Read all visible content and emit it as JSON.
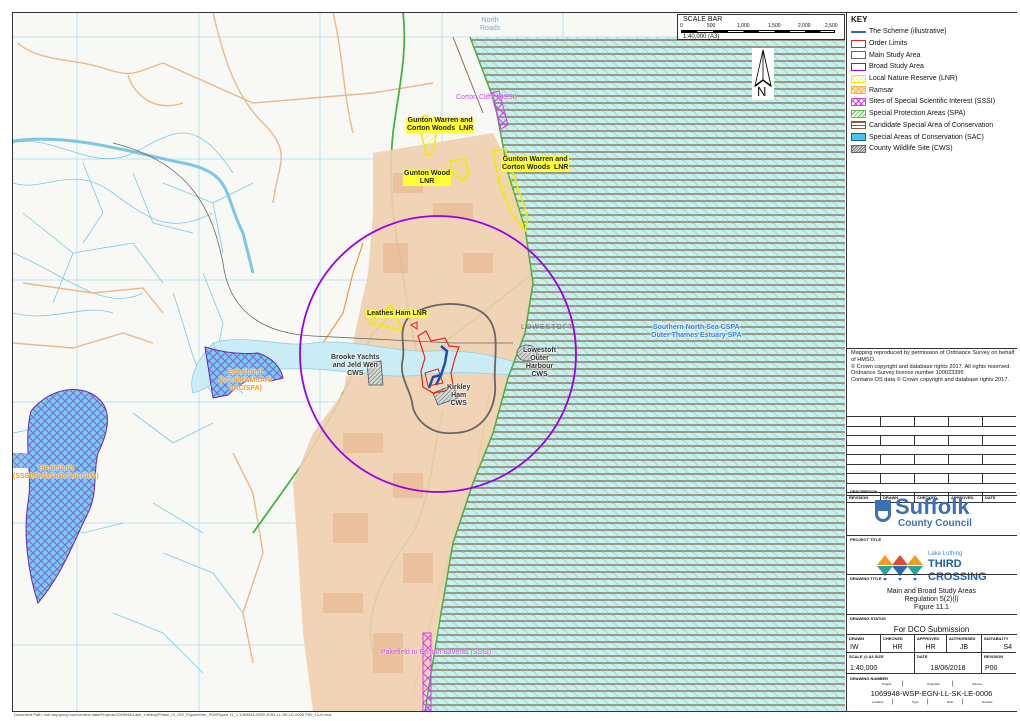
{
  "map": {
    "labels": {
      "corton_cliffs": "Corton Cliffs (SSSI)",
      "gunton_warren_1": "Gunton Warren and\nCorton Woods  LNR",
      "gunton_warren_2": "Gunton Warren and\nCorton Woods  LNR",
      "gunton_wood": "Gunton Wood\nLNR",
      "leathes_ham": "Leathes Ham LNR",
      "brooke_yachts": "Brooke Yachts\nand Jeld Wen\nCWS",
      "lowestoft_outer_harbour": "Lowestoft\nOuter\nHarbour\nCWS",
      "kirkley_ham": "Kirkley\nHam\nCWS",
      "lowestoft_town": "LOWESTOFT",
      "southern_north_sea": "Southern North Sea CSPA\nOuter Thames Estuary SPA",
      "broadland_1": "Broadland\n(SSSI/RAMSAR/\nSAC/SPA)",
      "broadland_2": "Broadland\n(SSSI/RAMSAR/SAC/SPA)",
      "pakefield": "Pakefield to Easton Bavents (SSSI)",
      "north_roads": "North\nRoads"
    },
    "colors": {
      "broad_study_area": "#9a00e6",
      "main_study_area": "#666666",
      "order_limits": "#e2241a",
      "scheme": "#1f4fa8",
      "lnr": "#f2ea00",
      "sssi": "#d43ce8",
      "spa_sea": "#bfeeea",
      "csac_stripe": "#8b6a4e",
      "water": "#c9ecf5",
      "urban": "#efcfae"
    }
  },
  "scale_bar": {
    "title": "SCALE BAR",
    "ticks": [
      "0",
      "500",
      "1,000",
      "1,500",
      "2,000",
      "2,500 m"
    ],
    "ratio": "1:40,000 (A3)"
  },
  "north_arrow": {
    "label": "N"
  },
  "key": {
    "title": "KEY",
    "items": [
      {
        "label": "The Scheme (illustrative)",
        "icon": "line-swatch"
      },
      {
        "label": "Order Limits",
        "icon": "red-outline-swatch"
      },
      {
        "label": "Main Study Area",
        "icon": "grey-outline-swatch"
      },
      {
        "label": "Broad Study Area",
        "icon": "purple-outline-swatch"
      },
      {
        "label": "Local Nature Reserve (LNR)",
        "icon": "yellow-hatch-swatch"
      },
      {
        "label": "Ramsar",
        "icon": "orange-crosshatch-swatch"
      },
      {
        "label": "Sites of Special Scientific Interest (SSSI)",
        "icon": "magenta-crosshatch-swatch"
      },
      {
        "label": "Special Protection Areas (SPA)",
        "icon": "green-hatch-swatch"
      },
      {
        "label": "Candidate Special Area of Conservation",
        "icon": "brown-stripe-swatch"
      },
      {
        "label": "Special Areas of Conservation (SAC)",
        "icon": "blue-fill-swatch"
      },
      {
        "label": "County Wildlife Site (CWS)",
        "icon": "grey-hatch-swatch"
      }
    ]
  },
  "copyright": "Mapping reproduced by permission of Ordnance Survey on behalf of HMSO.\n© Crown copyright and database rights 2017. All rights reserved.\nOrdnance Survey licence number 100023395\nContains OS data © Crown copyright and database rights 2017.",
  "revision_table": {
    "headers": [
      "REVISION",
      "DRAWN",
      "CHECKED",
      "APPROVED",
      "DATE"
    ],
    "description_label": "DESCRIPTION"
  },
  "logos": {
    "client_line1": "Suffolk",
    "client_line2": "County Council",
    "project_small": "Lake Lothing",
    "project_line1": "THIRD",
    "project_line2": "CROSSING"
  },
  "project_title_label": "PROJECT TITLE",
  "drawing_title": {
    "label": "DRAWING TITLE",
    "line1": "Main and Broad Study Areas",
    "line2": "Regulation 5(2)(l)",
    "line3": "Figure 11.1"
  },
  "drawing_status": {
    "label": "DRAWING STATUS",
    "value": "For DCO Submission"
  },
  "signoff": {
    "drawn_label": "DRAWN",
    "drawn": "IW",
    "checked_label": "CHECKED",
    "checked": "HR",
    "approved_label": "APPROVED",
    "approved": "HR",
    "authorised_label": "AUTHORISED",
    "authorised": "JB",
    "suitability_label": "SUITABILITY",
    "suitability": "S4"
  },
  "scale_date": {
    "scale_label": "SCALE @ A3 SIZE",
    "scale": "1:40,000",
    "date_label": "DATE",
    "date": "18/06/2018",
    "revision_label": "REVISION",
    "revision": "P00"
  },
  "drawing_number": {
    "label": "DRAWING NUMBER",
    "value": "1069948-WSP-EGN-LL-SK-LE-0006",
    "top_captions": [
      "Project",
      "Originator",
      "Volume"
    ],
    "bottom_captions": [
      "Location",
      "Type",
      "Role",
      "Number"
    ]
  },
  "document_path": "Document Path: \\\\uk.wspgroup.com\\central data\\Projects\\1069948\\Lake_Lothing\\Phase_III_GIS_Figures\\Ver_P00\\Figure 11_1 1069948-WSP-EGN-LL-SK-LE-0006 P00_13-6.mxd"
}
